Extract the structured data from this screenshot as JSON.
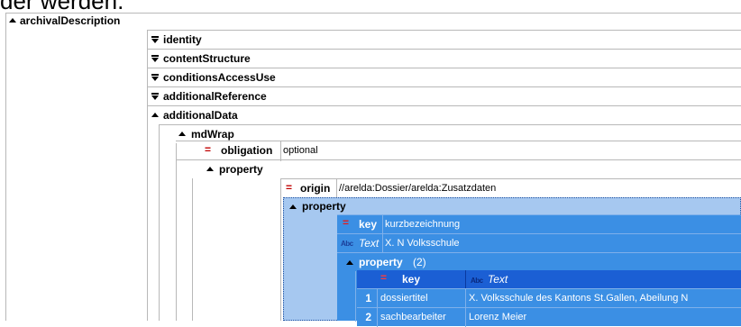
{
  "top_text": "der werden.",
  "tree": {
    "root": "archivalDescription",
    "children": {
      "identity": "identity",
      "contentStructure": "contentStructure",
      "conditionsAccessUse": "conditionsAccessUse",
      "additionalReference": "additionalReference",
      "additionalData": "additionalData"
    },
    "mdWrap": "mdWrap",
    "obligation": {
      "key": "obligation",
      "value": "optional"
    },
    "property": "property",
    "origin": {
      "key": "origin",
      "value": "//arelda:Dossier/arelda:Zusatzdaten"
    },
    "inner_property": "property",
    "key_row": {
      "key": "key",
      "value": "kurzbezeichnung"
    },
    "text_row": {
      "key": "Text",
      "value": "X. N Volksschule"
    },
    "property_group": {
      "label": "property",
      "count": "(2)"
    },
    "table": {
      "headers": [
        "key",
        "Text"
      ],
      "rows": [
        {
          "index": "1",
          "key": "dossiertitel",
          "text": "X. Volksschule des Kantons St.Gallen, Abeilung N"
        },
        {
          "index": "2",
          "key": "sachbearbeiter",
          "text": "Lorenz Meier"
        }
      ]
    }
  },
  "colors": {
    "selection": "#3b8fe4",
    "selection_header": "#1b5fd4",
    "attribute_marker": "#c00000"
  }
}
